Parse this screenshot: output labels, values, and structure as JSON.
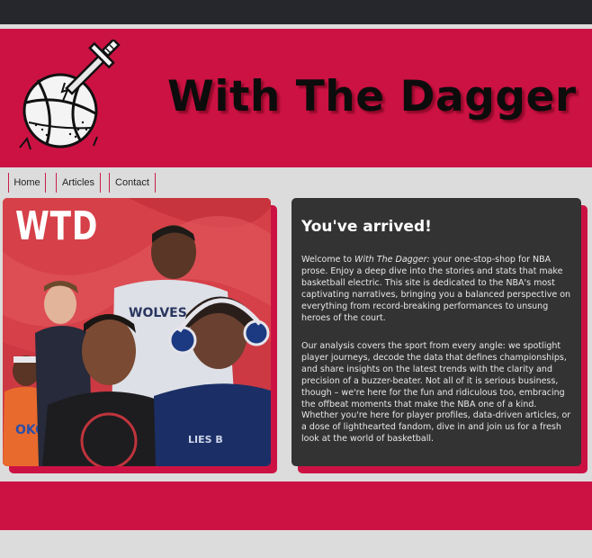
{
  "site": {
    "title": "With The Dagger",
    "logo_icon": "basketball-dagger-icon"
  },
  "nav": {
    "items": [
      {
        "label": "Home"
      },
      {
        "label": "Articles"
      },
      {
        "label": "Contact"
      }
    ]
  },
  "hero": {
    "logo_text": "WTD",
    "image": "nba-players-collage"
  },
  "card": {
    "title": "You've arrived!",
    "p1_prefix": "Welcome to ",
    "p1_emphasis": "With The Dagger:",
    "p1_rest": " your one-stop-shop for NBA prose. Enjoy a deep dive into the stories and stats that make basketball electric. This site is dedicated to the NBA's most captivating narratives, bringing you a balanced perspective on everything from record-breaking performances to unsung heroes of the court.",
    "p2": "Our analysis covers the sport from every angle: we spotlight player journeys, decode the data that defines championships, and share insights on the latest trends with the clarity and precision of a buzzer-beater. Not all of it is serious business, though – we're here for the fun and ridiculous too, embracing the offbeat moments that make the NBA one of a kind. Whether you're here for player profiles, data-driven articles, or a dose of lighthearted fandom, dive in and join us for a fresh look at the world of basketball."
  },
  "colors": {
    "brand_red": "#cc1243",
    "dark_bar": "#26272c",
    "card_bg": "#333333",
    "page_bg": "#dcdcdc"
  }
}
